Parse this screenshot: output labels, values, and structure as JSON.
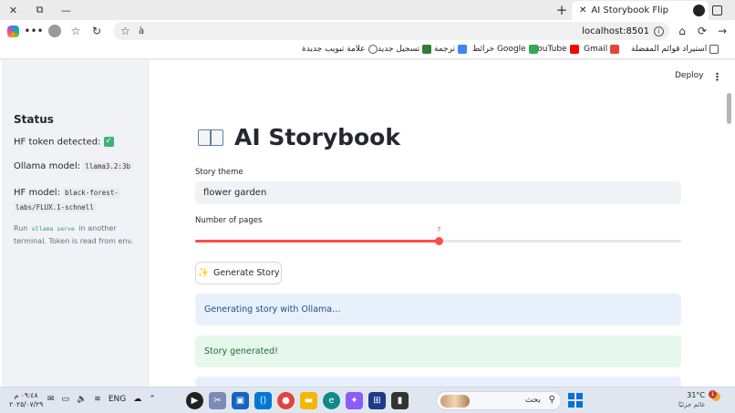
{
  "browser": {
    "tab_title": "AI Storybook Flip",
    "url": "localhost:8501",
    "search_hint": "à"
  },
  "bookmarks": [
    {
      "label": "استيراد قوائم المفضلة",
      "icon": "import-icon"
    },
    {
      "label": "Gmail",
      "icon": "gmail-icon"
    },
    {
      "label": "YouTube",
      "icon": "youtube-icon"
    },
    {
      "label": "Google خرائط",
      "icon": "maps-icon"
    },
    {
      "label": "ترجمة",
      "icon": "translate-icon"
    },
    {
      "label": "تسجيل جديد",
      "icon": "register-icon"
    },
    {
      "label": "علامة تبويب جديدة",
      "icon": "globe-icon"
    }
  ],
  "header": {
    "deploy_label": "Deploy"
  },
  "sidebar": {
    "title": "Status",
    "hf_token_label": "HF token detected:",
    "ollama_label": "Ollama model:",
    "ollama_value": "llama3.2:3b",
    "hf_model_label": "HF model:",
    "hf_model_value_1": "black-forest-",
    "hf_model_value_2": "labs/FLUX.1-schnell",
    "hint_pre": "Run",
    "hint_code": "ollama serve",
    "hint_post": "in another terminal. Token is read from env."
  },
  "main": {
    "title": "AI Storybook",
    "theme_label": "Story theme",
    "theme_value": "flower garden",
    "pages_label": "Number of pages",
    "pages_value": "7",
    "pages_fraction": 0.5,
    "generate_label": "Generate Story",
    "info_message": "Generating story with Ollama…",
    "success_message": "Story generated!"
  },
  "taskbar": {
    "time": "٠٩:٤٨ م",
    "date": "٢٠٢٥/٠٧/٢٩",
    "lang": "ENG",
    "search_label": "بحث",
    "temp": "31°C",
    "weather_text": "غائم جزئيًا",
    "badge": "1"
  },
  "colors": {
    "accent": "#ff4b4b",
    "sidebar_bg": "#f0f2f6",
    "info_bg": "#e8f1fb",
    "success_bg": "#e6f7ec"
  }
}
